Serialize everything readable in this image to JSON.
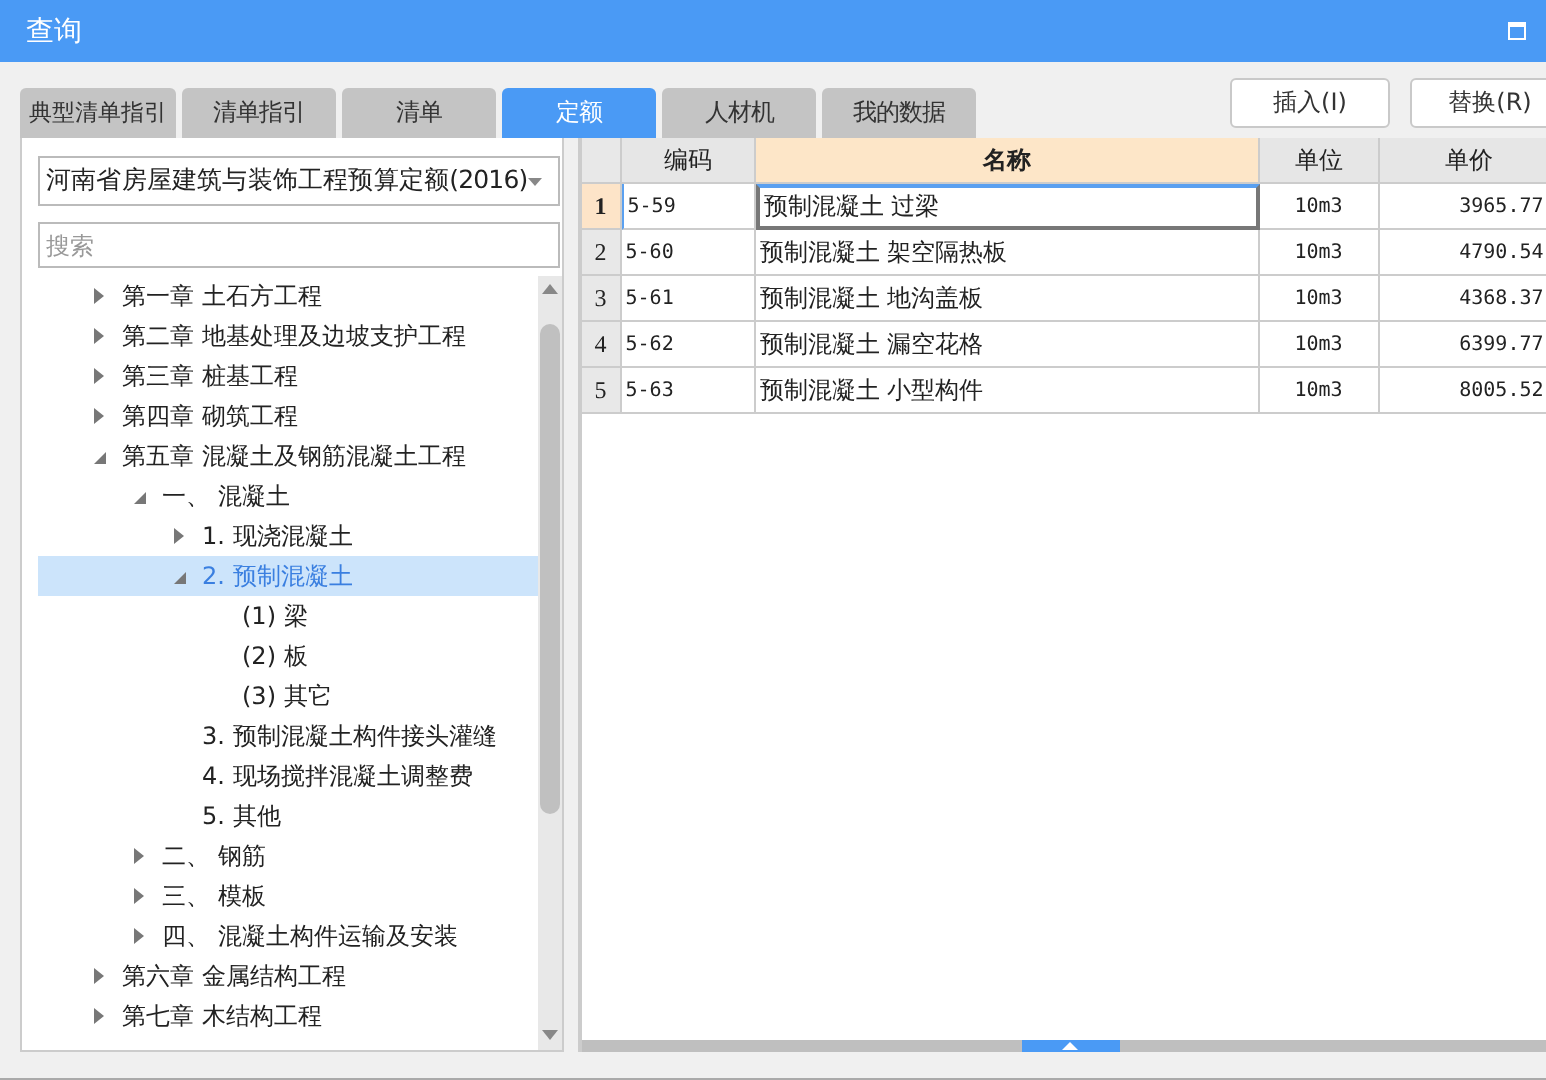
{
  "window": {
    "title": "查询"
  },
  "tabs": [
    {
      "label": "典型清单指引",
      "selected": false
    },
    {
      "label": "清单指引",
      "selected": false
    },
    {
      "label": "清单",
      "selected": false
    },
    {
      "label": "定额",
      "selected": true
    },
    {
      "label": "人材机",
      "selected": false
    },
    {
      "label": "我的数据",
      "selected": false
    }
  ],
  "buttons": [
    "插入(I)",
    "替换(R)"
  ],
  "library_select": {
    "value": "河南省房屋建筑与装饰工程预算定额(2016)"
  },
  "search": {
    "placeholder": "搜索"
  },
  "tree": [
    {
      "label": "第一章 土石方工程",
      "expanded": false,
      "selected": false
    },
    {
      "label": "第二章 地基处理及边坡支护工程",
      "expanded": false,
      "selected": false
    },
    {
      "label": "第三章 桩基工程",
      "expanded": false,
      "selected": false
    },
    {
      "label": "第四章 砌筑工程",
      "expanded": false,
      "selected": false
    },
    {
      "label": "第五章 混凝土及钢筋混凝土工程",
      "expanded": true,
      "selected": false,
      "children": [
        {
          "label": "一、  混凝土",
          "expanded": true,
          "selected": false,
          "children": [
            {
              "label": "1. 现浇混凝土",
              "expanded": false,
              "selected": false
            },
            {
              "label": "2. 预制混凝土",
              "expanded": true,
              "selected": true,
              "children": [
                {
                  "label": "(1) 梁",
                  "selected": false
                },
                {
                  "label": "(2) 板",
                  "selected": false
                },
                {
                  "label": "(3) 其它",
                  "selected": false
                }
              ]
            },
            {
              "label": "3. 预制混凝土构件接头灌缝",
              "selected": false
            },
            {
              "label": "4. 现场搅拌混凝土调整费",
              "selected": false
            },
            {
              "label": "5. 其他",
              "selected": false
            }
          ]
        },
        {
          "label": "二、  钢筋",
          "expanded": false,
          "selected": false
        },
        {
          "label": "三、  模板",
          "expanded": false,
          "selected": false
        },
        {
          "label": "四、  混凝土构件运输及安装",
          "expanded": false,
          "selected": false
        }
      ]
    },
    {
      "label": "第六章 金属结构工程",
      "expanded": false,
      "selected": false
    },
    {
      "label": "第七章 木结构工程",
      "expanded": false,
      "selected": false
    }
  ],
  "table": {
    "columns": [
      {
        "label": "编码",
        "selected": false
      },
      {
        "label": "名称",
        "selected": true
      },
      {
        "label": "单位",
        "selected": false
      },
      {
        "label": "单价",
        "selected": false
      }
    ],
    "rows": [
      {
        "index": "1",
        "selected": true,
        "cells": [
          "5-59",
          "预制混凝土 过梁",
          "10m3",
          "3965.77"
        ]
      },
      {
        "index": "2",
        "selected": false,
        "cells": [
          "5-60",
          "预制混凝土 架空隔热板",
          "10m3",
          "4790.54"
        ]
      },
      {
        "index": "3",
        "selected": false,
        "cells": [
          "5-61",
          "预制混凝土 地沟盖板",
          "10m3",
          "4368.37"
        ]
      },
      {
        "index": "4",
        "selected": false,
        "cells": [
          "5-62",
          "预制混凝土 漏空花格",
          "10m3",
          "6399.77"
        ]
      },
      {
        "index": "5",
        "selected": false,
        "cells": [
          "5-63",
          "预制混凝土 小型构件",
          "10m3",
          "8005.52"
        ]
      }
    ]
  }
}
